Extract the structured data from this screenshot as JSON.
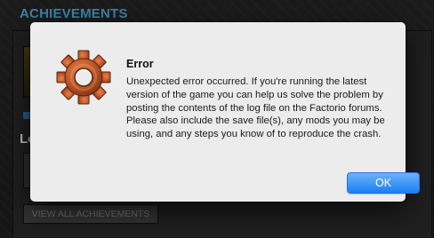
{
  "background": {
    "header": "ACHIEVEMENTS",
    "section_label": "Lo",
    "view_all_label": "VIEW ALL ACHIEVEMENTS"
  },
  "dialog": {
    "title": "Error",
    "message": [
      "Unexpected error occurred. If you're running the latest version of the game you can help us solve the problem by posting the contents of the log file on the Factorio forums.",
      "Please also include the save file(s), any mods you may be using, and any steps you know of to reproduce the crash."
    ],
    "ok_label": "OK",
    "icon": "gear-icon"
  },
  "colors": {
    "header": "#4aa0d0",
    "dialog_bg": "#ececec",
    "button": "#1b7ff4",
    "gear": "#c2592a"
  }
}
